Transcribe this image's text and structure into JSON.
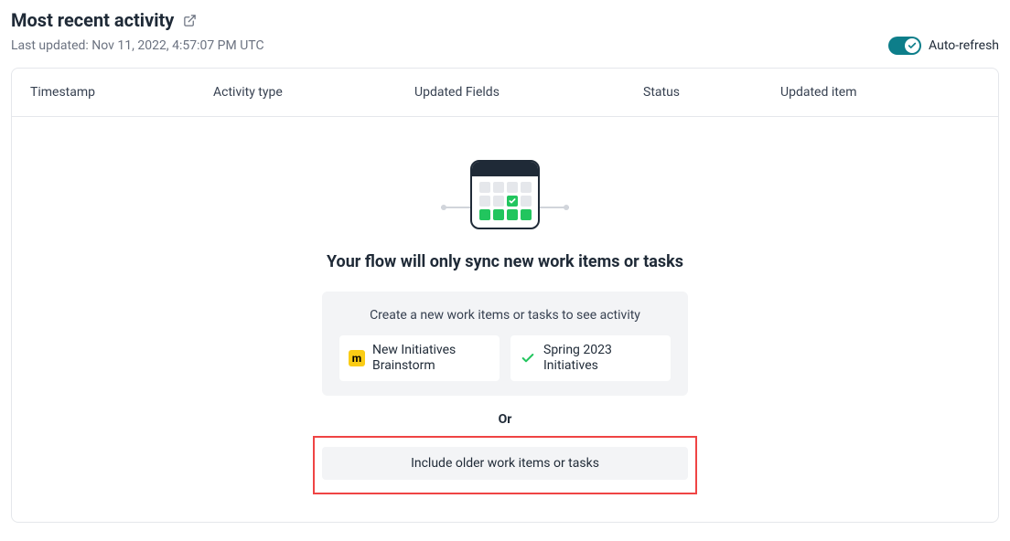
{
  "header": {
    "title": "Most recent activity",
    "last_updated_prefix": "Last updated: ",
    "last_updated_value": "Nov 11, 2022, 4:57:07 PM UTC",
    "auto_refresh_label": "Auto-refresh"
  },
  "columns": {
    "timestamp": "Timestamp",
    "activity_type": "Activity type",
    "updated_fields": "Updated Fields",
    "status": "Status",
    "updated_item": "Updated item"
  },
  "empty": {
    "title": "Your flow will only sync new work items or tasks",
    "hint": "Create a new work items or tasks to see activity",
    "cards": [
      {
        "icon": "miro",
        "label": "New Initiatives Brainstorm"
      },
      {
        "icon": "check",
        "label": "Spring 2023 Initiatives"
      }
    ],
    "or": "Or",
    "older_button": "Include older work items or tasks"
  }
}
